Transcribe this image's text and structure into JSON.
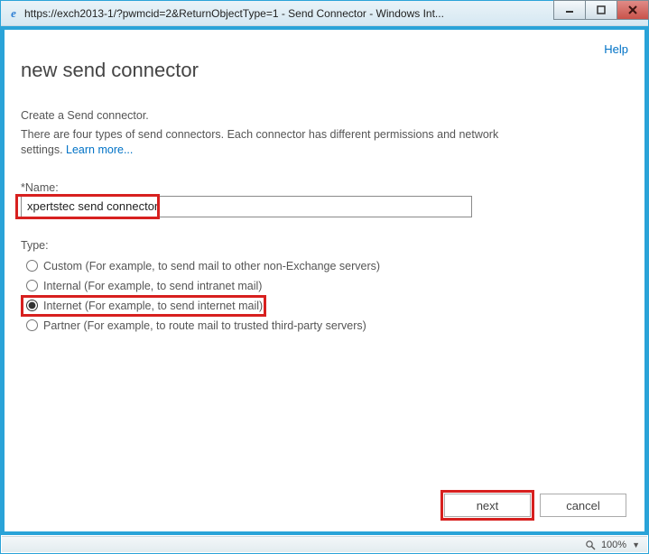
{
  "window": {
    "title": "https://exch2013-1/?pwmcid=2&ReturnObjectType=1 - Send Connector - Windows Int..."
  },
  "help_label": "Help",
  "page_title": "new send connector",
  "intro1": "Create a Send connector.",
  "intro2_prefix": "There are four types of send connectors. Each connector has different permissions and network settings. ",
  "learn_more": "Learn more...",
  "name_label": "*Name:",
  "name_value": "xpertstec send connector",
  "type_label": "Type:",
  "radios": [
    {
      "label": "Custom (For example, to send mail to other non-Exchange servers)",
      "checked": false
    },
    {
      "label": "Internal (For example, to send intranet mail)",
      "checked": false
    },
    {
      "label": "Internet (For example, to send internet mail)",
      "checked": true
    },
    {
      "label": "Partner (For example, to route mail to trusted third-party servers)",
      "checked": false
    }
  ],
  "buttons": {
    "next": "next",
    "cancel": "cancel"
  },
  "status": {
    "zoom": "100%"
  }
}
